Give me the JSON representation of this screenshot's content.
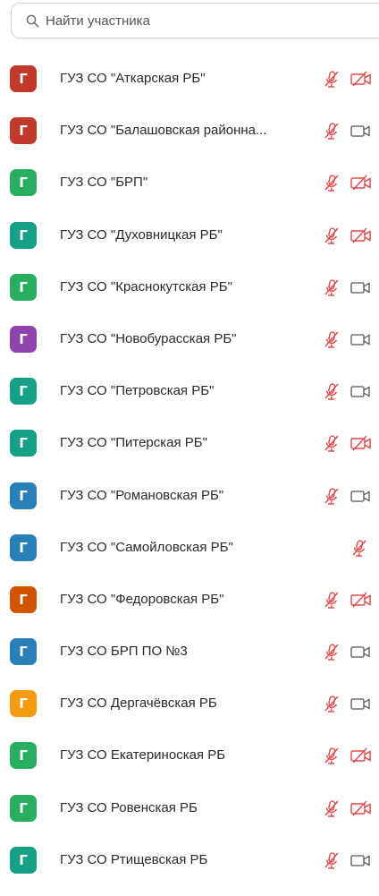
{
  "search": {
    "placeholder": "Найти участника"
  },
  "participants": [
    {
      "name": "ГУЗ СО \"Аткарская РБ\"",
      "initial": "Г",
      "color": "#c0392b",
      "mic": "muted",
      "cam": "off"
    },
    {
      "name": "ГУЗ СО \"Балашовская районна...",
      "initial": "Г",
      "color": "#c0392b",
      "mic": "muted",
      "cam": "on"
    },
    {
      "name": "ГУЗ СО \"БРП\"",
      "initial": "Г",
      "color": "#27ae60",
      "mic": "muted",
      "cam": "off"
    },
    {
      "name": "ГУЗ СО \"Духовницкая РБ\"",
      "initial": "Г",
      "color": "#16a085",
      "mic": "muted",
      "cam": "off"
    },
    {
      "name": "ГУЗ СО \"Краснокутская РБ\"",
      "initial": "Г",
      "color": "#27ae60",
      "mic": "muted",
      "cam": "on"
    },
    {
      "name": "ГУЗ СО \"Новобурасская РБ\"",
      "initial": "Г",
      "color": "#8e44ad",
      "mic": "muted",
      "cam": "on"
    },
    {
      "name": "ГУЗ СО \"Петровская РБ\"",
      "initial": "Г",
      "color": "#16a085",
      "mic": "muted",
      "cam": "on"
    },
    {
      "name": "ГУЗ СО \"Питерская РБ\"",
      "initial": "Г",
      "color": "#16a085",
      "mic": "muted",
      "cam": "off"
    },
    {
      "name": "ГУЗ СО \"Романовская РБ\"",
      "initial": "Г",
      "color": "#2980b9",
      "mic": "muted",
      "cam": "on"
    },
    {
      "name": "ГУЗ СО \"Самойловская РБ\"",
      "initial": "Г",
      "color": "#2980b9",
      "mic": "muted",
      "cam": "none"
    },
    {
      "name": "ГУЗ СО \"Федоровская РБ\"",
      "initial": "Г",
      "color": "#d35400",
      "mic": "muted",
      "cam": "off"
    },
    {
      "name": "ГУЗ СО БРП ПО №3",
      "initial": "Г",
      "color": "#2980b9",
      "mic": "muted",
      "cam": "on"
    },
    {
      "name": "ГУЗ СО Дергачёвская РБ",
      "initial": "Г",
      "color": "#f39c12",
      "mic": "muted",
      "cam": "on"
    },
    {
      "name": "ГУЗ СО Екатериноская РБ",
      "initial": "Г",
      "color": "#27ae60",
      "mic": "muted",
      "cam": "off"
    },
    {
      "name": "ГУЗ СО Ровенская РБ",
      "initial": "Г",
      "color": "#27ae60",
      "mic": "muted",
      "cam": "off"
    },
    {
      "name": "ГУЗ СО Ртищевская РБ",
      "initial": "Г",
      "color": "#16a085",
      "mic": "muted",
      "cam": "on"
    }
  ]
}
